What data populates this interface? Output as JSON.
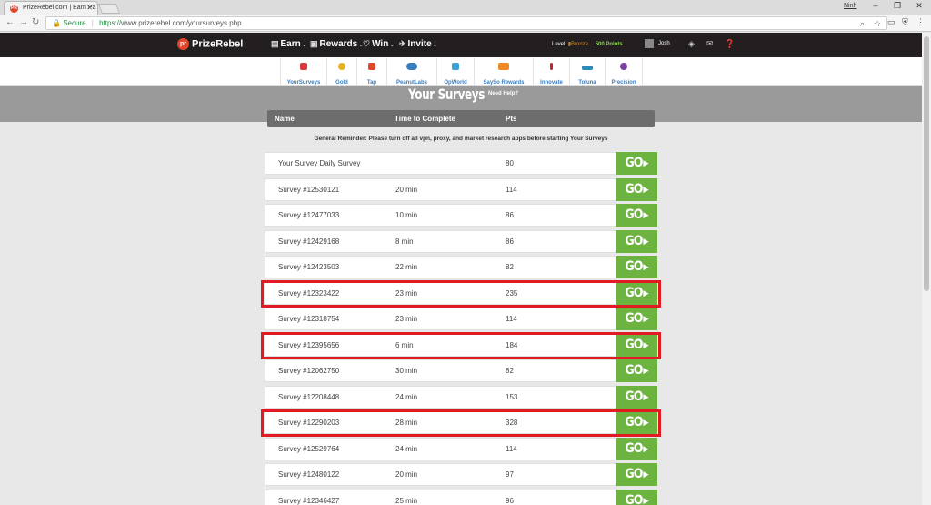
{
  "browser": {
    "tab_title": "PrizeRebel.com | Earn Pa",
    "favicon_text": "PR",
    "window_user": "Ninh",
    "secure_label": "Secure",
    "url_scheme": "https://",
    "url_rest": "www.prizerebel.com/yoursurveys.php"
  },
  "header": {
    "logo_text": "PrizeRebel",
    "logo_mark": "pr",
    "menu": [
      {
        "label": "Earn"
      },
      {
        "label": "Rewards"
      },
      {
        "label": "Win"
      },
      {
        "label": "Invite"
      }
    ],
    "level_label": "Level:",
    "level_value": "Bronze",
    "points": "500 Points",
    "username": "Josh"
  },
  "offerwalls": [
    {
      "label": "YourSurveys",
      "color": "#d63a3a"
    },
    {
      "label": "Gold",
      "color": "#e8b020"
    },
    {
      "label": "Tap",
      "color": "#e2452c"
    },
    {
      "label": "PeanutLabs",
      "color": "#3a7dbf"
    },
    {
      "label": "OpWorld",
      "color": "#3aa0d6"
    },
    {
      "label": "SaySo Rewards",
      "color": "#f08a24"
    },
    {
      "label": "Innovate",
      "color": "#c0282d"
    },
    {
      "label": "Toluna",
      "color": "#2a8ab8"
    },
    {
      "label": "Precision",
      "color": "#7a3fa0"
    }
  ],
  "page": {
    "title": "Your Surveys",
    "help": "Need Help?",
    "col_name": "Name",
    "col_time": "Time to Complete",
    "col_pts": "Pts",
    "reminder": "General Reminder: Please turn off all vpn, proxy, and market research apps before starting Your Surveys",
    "go_label": "GO"
  },
  "surveys": [
    {
      "name": "Your Survey Daily Survey",
      "time": "",
      "pts": "80",
      "highlighted": false
    },
    {
      "name": "Survey #12530121",
      "time": "20 min",
      "pts": "114",
      "highlighted": false
    },
    {
      "name": "Survey #12477033",
      "time": "10 min",
      "pts": "86",
      "highlighted": false
    },
    {
      "name": "Survey #12429168",
      "time": "8 min",
      "pts": "86",
      "highlighted": false
    },
    {
      "name": "Survey #12423503",
      "time": "22 min",
      "pts": "82",
      "highlighted": false
    },
    {
      "name": "Survey #12323422",
      "time": "23 min",
      "pts": "235",
      "highlighted": true
    },
    {
      "name": "Survey #12318754",
      "time": "23 min",
      "pts": "114",
      "highlighted": false
    },
    {
      "name": "Survey #12395656",
      "time": "6 min",
      "pts": "184",
      "highlighted": true
    },
    {
      "name": "Survey #12062750",
      "time": "30 min",
      "pts": "82",
      "highlighted": false
    },
    {
      "name": "Survey #12208448",
      "time": "24 min",
      "pts": "153",
      "highlighted": false
    },
    {
      "name": "Survey #12290203",
      "time": "28 min",
      "pts": "328",
      "highlighted": true
    },
    {
      "name": "Survey #12529764",
      "time": "24 min",
      "pts": "114",
      "highlighted": false
    },
    {
      "name": "Survey #12480122",
      "time": "20 min",
      "pts": "97",
      "highlighted": false
    },
    {
      "name": "Survey #12346427",
      "time": "25 min",
      "pts": "96",
      "highlighted": false
    }
  ]
}
